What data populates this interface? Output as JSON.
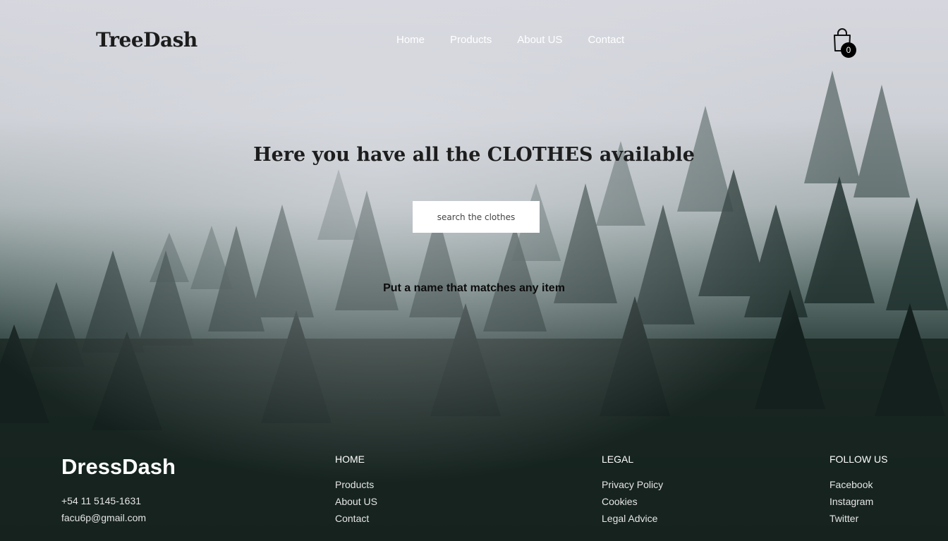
{
  "header": {
    "logo": "TreeDash",
    "nav": [
      "Home",
      "Products",
      "About US",
      "Contact"
    ],
    "cart_count": "0"
  },
  "hero": {
    "title": "Here you have all the CLOTHES available",
    "search_placeholder": "search the clothes",
    "hint": "Put a name that matches any item"
  },
  "footer": {
    "brand": "DressDash",
    "phone": "+54 11 5145-1631",
    "email": "facu6p@gmail.com",
    "columns": [
      {
        "heading": "HOME",
        "links": [
          "Products",
          "About US",
          "Contact"
        ]
      },
      {
        "heading": "LEGAL",
        "links": [
          "Privacy Policy",
          "Cookies",
          "Legal Advice"
        ]
      },
      {
        "heading": "FOLLOW US",
        "links": [
          "Facebook",
          "Instagram",
          "Twitter"
        ]
      }
    ]
  },
  "colors": {
    "text_dark": "#1c1c1c",
    "text_light": "#ffffff",
    "badge": "#000000"
  },
  "icons": [
    "shopping-bag-icon"
  ]
}
